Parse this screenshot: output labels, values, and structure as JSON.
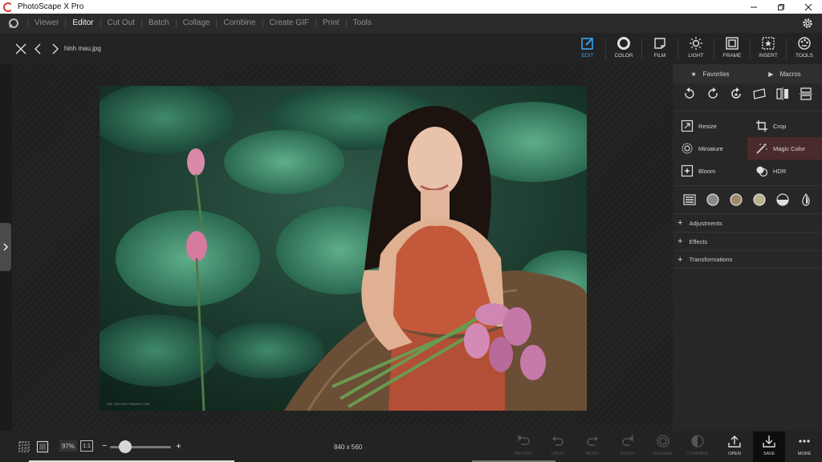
{
  "window": {
    "title": "PhotoScape X Pro",
    "controls": [
      "minimize",
      "restore",
      "close"
    ]
  },
  "menu": {
    "items": [
      "Viewer",
      "Editor",
      "Cut Out",
      "Batch",
      "Collage",
      "Combine",
      "Create GIF",
      "Print",
      "Tools"
    ],
    "active": "Editor"
  },
  "header": {
    "filename": "hinh mau.jpg"
  },
  "tool_tabs": [
    {
      "label": "EDIT",
      "icon": "edit-icon",
      "active": true
    },
    {
      "label": "COLOR",
      "icon": "color-icon",
      "active": false
    },
    {
      "label": "FILM",
      "icon": "film-icon",
      "active": false
    },
    {
      "label": "LIGHT",
      "icon": "light-icon",
      "active": false
    },
    {
      "label": "FRAME",
      "icon": "frame-icon",
      "active": false
    },
    {
      "label": "INSERT",
      "icon": "insert-icon",
      "active": false
    },
    {
      "label": "TOOLS",
      "icon": "tools-icon",
      "active": false
    }
  ],
  "panel": {
    "tabs": {
      "favorites": "Favorites",
      "macros": "Macros"
    },
    "buttons": {
      "resize": "Resize",
      "crop": "Crop",
      "miniature": "Miniature",
      "magic_color": "Magic Color",
      "bloom": "Bloom",
      "hdr": "HDR"
    },
    "accordions": {
      "adjustments": "Adjustments",
      "effects": "Effects",
      "transformations": "Transformations"
    }
  },
  "canvas": {
    "watermark": "THE TRUONGTHAIANH.COM"
  },
  "bottom": {
    "zoom_level": "97%",
    "one_to_one": "1:1",
    "image_size": "840 x 560",
    "actions": {
      "revert": "REVERT",
      "undo": "UNDO",
      "redo": "REDO",
      "redo_all": "REDO+",
      "original": "ORIGINAL",
      "compare": "COMPARE",
      "open": "OPEN",
      "save": "SAVE",
      "more": "MORE"
    }
  },
  "colors": {
    "accent": "#3aa0f0",
    "highlight": "#4a2a2a",
    "logo_red": "#d83b2e"
  }
}
